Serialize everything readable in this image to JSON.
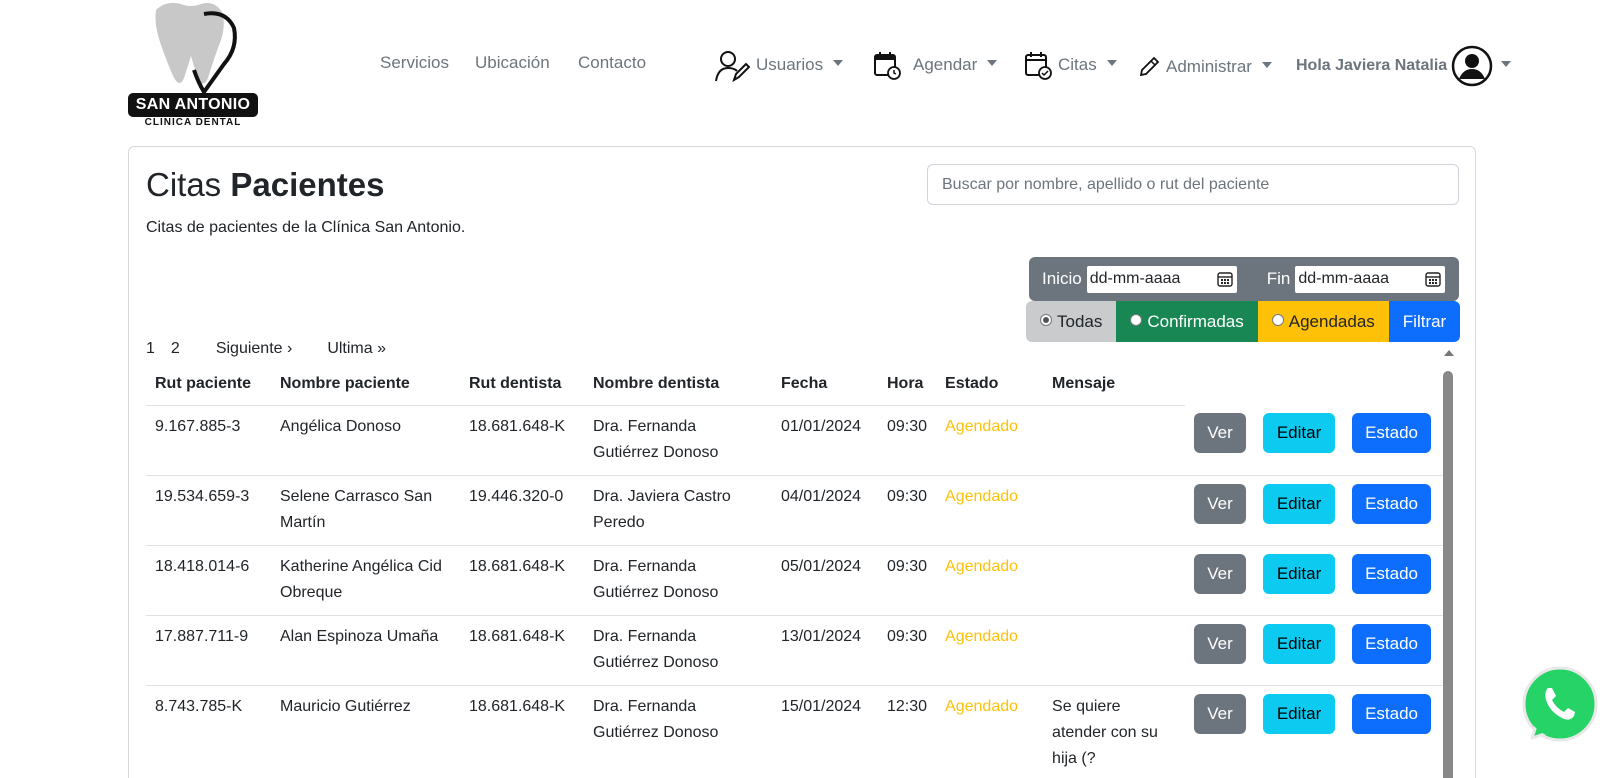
{
  "logo": {
    "name": "SAN ANTONIO",
    "sub": "CLINICA DENTAL"
  },
  "nav": {
    "servicios": "Servicios",
    "ubicacion": "Ubicación",
    "contacto": "Contacto",
    "usuarios": "Usuarios",
    "agendar": "Agendar",
    "citas": "Citas",
    "administrar": "Administrar",
    "greeting": "Hola Javiera Natalia"
  },
  "page": {
    "title_light": "Citas",
    "title_bold": "Pacientes",
    "subtitle": "Citas de pacientes de la Clínica San Antonio.",
    "search_placeholder": "Buscar por nombre, apellido o rut del paciente"
  },
  "filters": {
    "inicio_label": "Inicio",
    "fin_label": "Fin",
    "date_placeholder": "dd-mm-aaaa",
    "todas": "Todas",
    "confirmadas": "Confirmadas",
    "agendadas": "Agendadas",
    "filtrar": "Filtrar",
    "selected": "Todas"
  },
  "pagination": {
    "p1": "1",
    "p2": "2",
    "next": "Siguiente ›",
    "last": "Ultima »"
  },
  "table": {
    "headers": [
      "Rut paciente",
      "Nombre paciente",
      "Rut dentista",
      "Nombre dentista",
      "Fecha",
      "Hora",
      "Estado",
      "Mensaje"
    ],
    "buttons": {
      "ver": "Ver",
      "editar": "Editar",
      "estado": "Estado"
    },
    "rows": [
      {
        "rut_paciente": "9.167.885-3",
        "nombre_paciente": "Angélica Donoso",
        "rut_dentista": "18.681.648-K",
        "nombre_dentista": "Dra. Fernanda Gutiérrez Donoso",
        "fecha": "01/01/2024",
        "hora": "09:30",
        "estado": "Agendado",
        "mensaje": ""
      },
      {
        "rut_paciente": "19.534.659-3",
        "nombre_paciente": "Selene Carrasco San Martín",
        "rut_dentista": "19.446.320-0",
        "nombre_dentista": "Dra. Javiera Castro Peredo",
        "fecha": "04/01/2024",
        "hora": "09:30",
        "estado": "Agendado",
        "mensaje": ""
      },
      {
        "rut_paciente": "18.418.014-6",
        "nombre_paciente": "Katherine Angélica Cid Obreque",
        "rut_dentista": "18.681.648-K",
        "nombre_dentista": "Dra. Fernanda Gutiérrez Donoso",
        "fecha": "05/01/2024",
        "hora": "09:30",
        "estado": "Agendado",
        "mensaje": ""
      },
      {
        "rut_paciente": "17.887.711-9",
        "nombre_paciente": "Alan Espinoza Umaña",
        "rut_dentista": "18.681.648-K",
        "nombre_dentista": "Dra. Fernanda Gutiérrez Donoso",
        "fecha": "13/01/2024",
        "hora": "09:30",
        "estado": "Agendado",
        "mensaje": ""
      },
      {
        "rut_paciente": "8.743.785-K",
        "nombre_paciente": "Mauricio Gutiérrez",
        "rut_dentista": "18.681.648-K",
        "nombre_dentista": "Dra. Fernanda Gutiérrez Donoso",
        "fecha": "15/01/2024",
        "hora": "12:30",
        "estado": "Agendado",
        "mensaje": "Se quiere atender con su hija (?"
      }
    ]
  },
  "colors": {
    "estado_agendado": "#ffc107",
    "primary": "#0d6efd",
    "info": "#0dcaf0",
    "secondary": "#6c757d",
    "success": "#198754"
  }
}
